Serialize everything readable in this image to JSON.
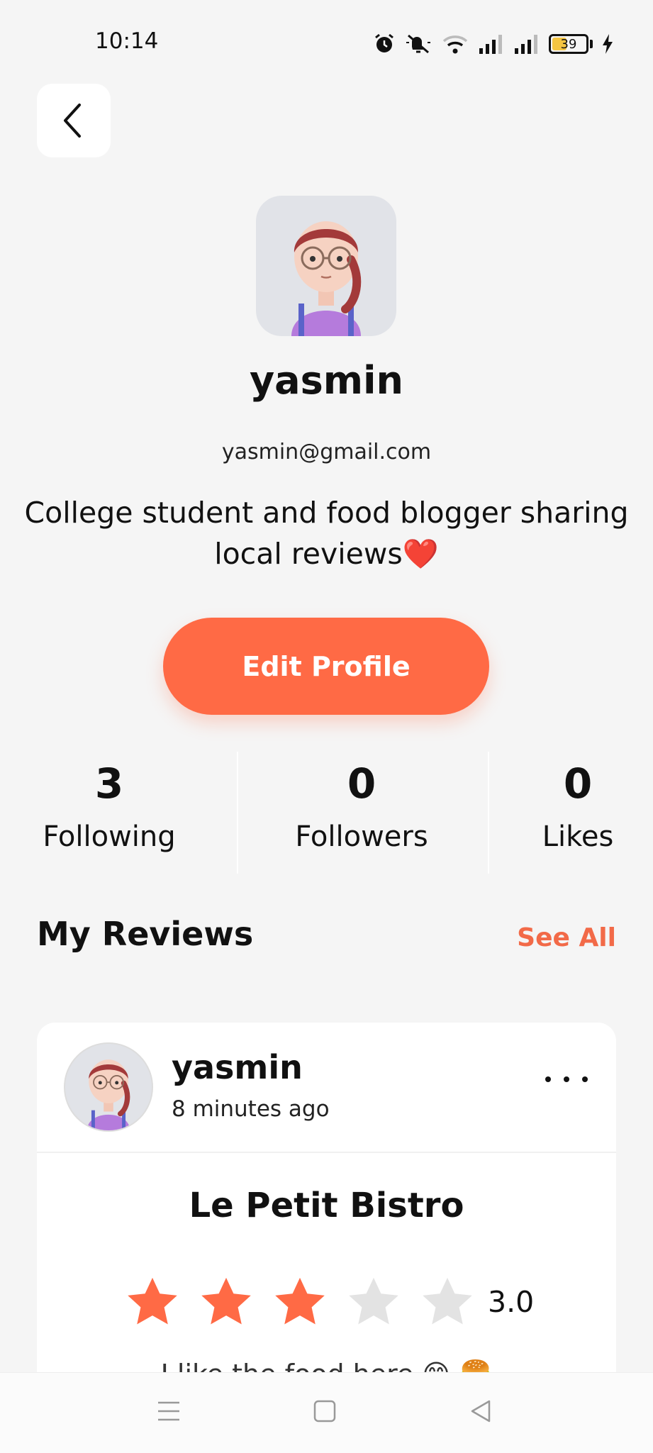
{
  "status_bar": {
    "time": "10:14",
    "battery": "39"
  },
  "profile": {
    "username": "yasmin",
    "email": "yasmin@gmail.com",
    "bio": "College student and food blogger sharing local reviews❤️",
    "edit_button": "Edit Profile"
  },
  "stats": [
    {
      "value": "3",
      "label": "Following"
    },
    {
      "value": "0",
      "label": "Followers"
    },
    {
      "value": "0",
      "label": "Likes"
    }
  ],
  "reviews_section": {
    "title": "My Reviews",
    "see_all": "See All"
  },
  "review": {
    "username": "yasmin",
    "time": "8 minutes ago",
    "restaurant": "Le Petit Bistro",
    "rating": 3,
    "rating_text": "3.0",
    "max_rating": 5,
    "snippet_partial": "I like the food here 😋 🍔"
  },
  "colors": {
    "accent": "#ff6a45",
    "star_filled": "#ff6a45",
    "star_empty": "#e3e3e3",
    "background": "#f5f5f5"
  },
  "icons": [
    "back-chevron-icon",
    "alarm-icon",
    "mute-icon",
    "wifi-icon",
    "signal-icon",
    "battery-icon",
    "charging-icon",
    "more-icon",
    "star-icon",
    "menu-icon",
    "home-square-icon",
    "back-triangle-icon"
  ]
}
